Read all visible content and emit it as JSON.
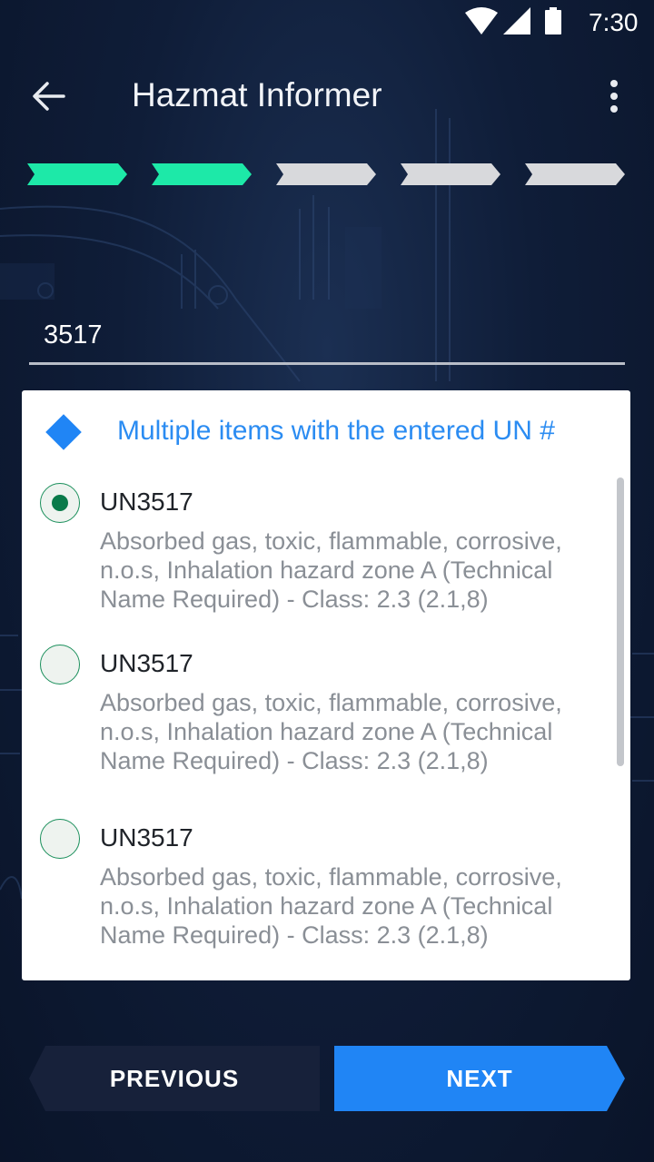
{
  "status_bar": {
    "time": "7:30",
    "icons": [
      "wifi-icon",
      "signal-icon",
      "battery-icon"
    ]
  },
  "app_bar": {
    "title": "Hazmat Informer",
    "back_icon": "arrow-left-icon",
    "menu_icon": "more-vert-icon"
  },
  "progress": {
    "total_steps": 5,
    "completed_steps": 2,
    "active_color": "#1de9a8",
    "inactive_color": "#d8d9dc"
  },
  "search": {
    "value": "3517"
  },
  "results_card": {
    "title": "Multiple items with the entered UN #",
    "title_icon": "diamond-icon",
    "accent_color": "#2b8cf2",
    "options": [
      {
        "code": "UN3517",
        "description": "Absorbed gas, toxic, flammable, corrosive, n.o.s, Inhalation hazard zone A (Technical Name Required) - Class: 2.3 (2.1,8)",
        "selected": true
      },
      {
        "code": "UN3517",
        "description": "Absorbed gas, toxic, flammable, corrosive, n.o.s, Inhalation hazard zone A (Technical Name Required) - Class: 2.3 (2.1,8)",
        "selected": false
      },
      {
        "code": "UN3517",
        "description": "Absorbed gas, toxic, flammable, corrosive, n.o.s, Inhalation hazard zone A (Technical Name Required) - Class: 2.3 (2.1,8)",
        "selected": false
      }
    ]
  },
  "navigation": {
    "previous_label": "PREVIOUS",
    "next_label": "NEXT",
    "next_color": "#2085f5"
  }
}
